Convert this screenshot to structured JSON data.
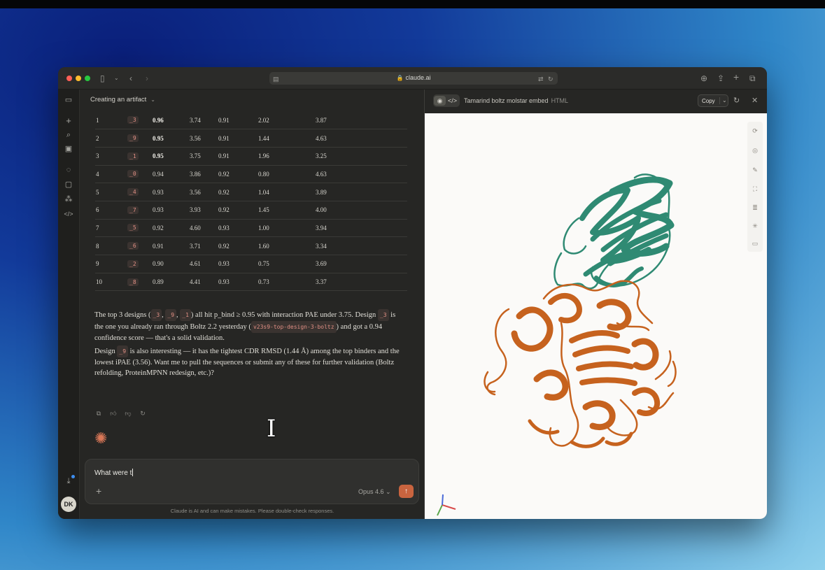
{
  "browser": {
    "url": "claude.ai"
  },
  "chat": {
    "title": "Creating an artifact",
    "rows": [
      {
        "rank": "1",
        "design": "_3",
        "pbind": "0.96",
        "ipae": "3.74",
        "ptm": "0.91",
        "rmsd": "2.02",
        "last": "3.87",
        "bold": true
      },
      {
        "rank": "2",
        "design": "_9",
        "pbind": "0.95",
        "ipae": "3.56",
        "ptm": "0.91",
        "rmsd": "1.44",
        "last": "4.63",
        "bold": true
      },
      {
        "rank": "3",
        "design": "_1",
        "pbind": "0.95",
        "ipae": "3.75",
        "ptm": "0.91",
        "rmsd": "1.96",
        "last": "3.25",
        "bold": true
      },
      {
        "rank": "4",
        "design": "_0",
        "pbind": "0.94",
        "ipae": "3.86",
        "ptm": "0.92",
        "rmsd": "0.80",
        "last": "4.63",
        "bold": false
      },
      {
        "rank": "5",
        "design": "_4",
        "pbind": "0.93",
        "ipae": "3.56",
        "ptm": "0.92",
        "rmsd": "1.04",
        "last": "3.89",
        "bold": false
      },
      {
        "rank": "6",
        "design": "_7",
        "pbind": "0.93",
        "ipae": "3.93",
        "ptm": "0.92",
        "rmsd": "1.45",
        "last": "4.00",
        "bold": false
      },
      {
        "rank": "7",
        "design": "_5",
        "pbind": "0.92",
        "ipae": "4.60",
        "ptm": "0.93",
        "rmsd": "1.00",
        "last": "3.94",
        "bold": false
      },
      {
        "rank": "8",
        "design": "_6",
        "pbind": "0.91",
        "ipae": "3.71",
        "ptm": "0.92",
        "rmsd": "1.60",
        "last": "3.34",
        "bold": false
      },
      {
        "rank": "9",
        "design": "_2",
        "pbind": "0.90",
        "ipae": "4.61",
        "ptm": "0.93",
        "rmsd": "0.75",
        "last": "3.69",
        "bold": false
      },
      {
        "rank": "10",
        "design": "_8",
        "pbind": "0.89",
        "ipae": "4.41",
        "ptm": "0.93",
        "rmsd": "0.73",
        "last": "3.37",
        "bold": false
      }
    ],
    "para1": {
      "t1": "The top 3 designs (",
      "c1": "_3",
      "t2": ", ",
      "c2": "_9",
      "t3": ", ",
      "c3": "_1",
      "t4": ") all hit p_bind ≥ 0.95 with interaction PAE under 3.75. Design ",
      "c4": "_3",
      "t5": " is the one you already ran through Boltz 2.2 yesterday (",
      "c5": "v23s9-top-design-3-boltz",
      "t6": ") and got a 0.94 confidence score — that's a solid validation."
    },
    "para2": {
      "t1": "Design ",
      "c1": "_9",
      "t2": " is also interesting — it has the tightest CDR RMSD (1.44 Å) among the top binders and the lowest iPAE (3.56). Want me to pull the sequences or submit any of these for further validation (Boltz refolding, ProteinMPNN redesign, etc.)?"
    },
    "composer": {
      "input_value": "What were t",
      "model": "Opus 4.6",
      "model_chevron": "⌄"
    },
    "disclaimer": "Claude is AI and can make mistakes. Please double-check responses."
  },
  "user": {
    "initials": "DK"
  },
  "artifact": {
    "title": "Tamarind boltz molstar embed",
    "type": "HTML",
    "copy_label": "Copy",
    "colors": {
      "chain_a": "#2f8a73",
      "chain_b": "#c6621e"
    }
  }
}
